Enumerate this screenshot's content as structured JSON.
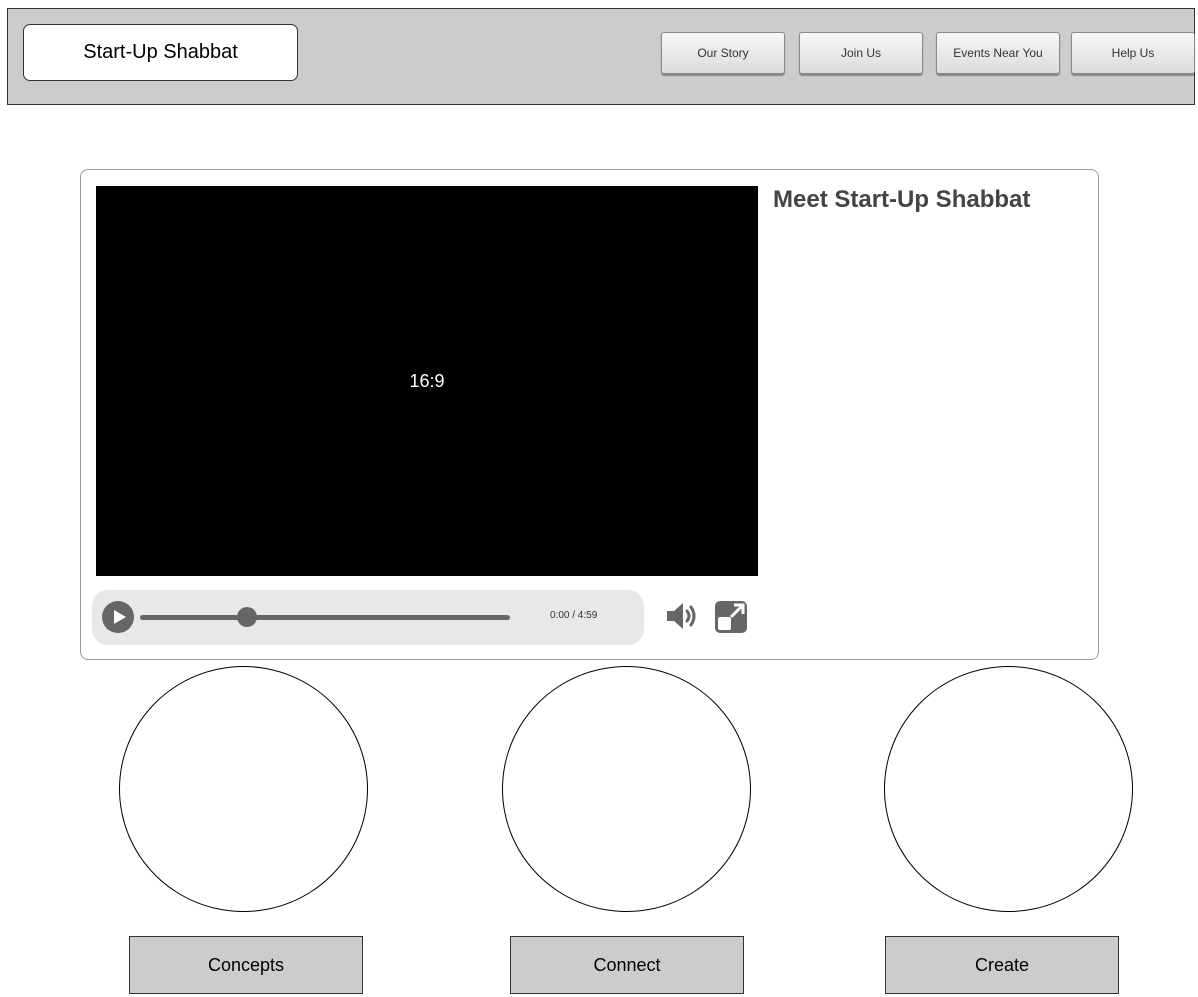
{
  "header": {
    "logo": "Start-Up Shabbat",
    "nav": [
      "Our Story",
      "Join Us",
      "Events Near You",
      "Help Us"
    ]
  },
  "main": {
    "title": "Meet Start-Up Shabbat",
    "video": {
      "placeholder": "16:9",
      "time": "0:00  /  4:59",
      "progress_fraction": 0.29
    }
  },
  "sections": [
    "Concepts",
    "Connect",
    "Create"
  ],
  "colors": {
    "header_bg": "#cccccc",
    "title_text": "#444444",
    "video_bg": "#000000",
    "control_bg": "#e8e8e8",
    "control_fg": "#666666"
  },
  "icons": [
    "play-icon",
    "volume-icon",
    "fullscreen-icon"
  ]
}
